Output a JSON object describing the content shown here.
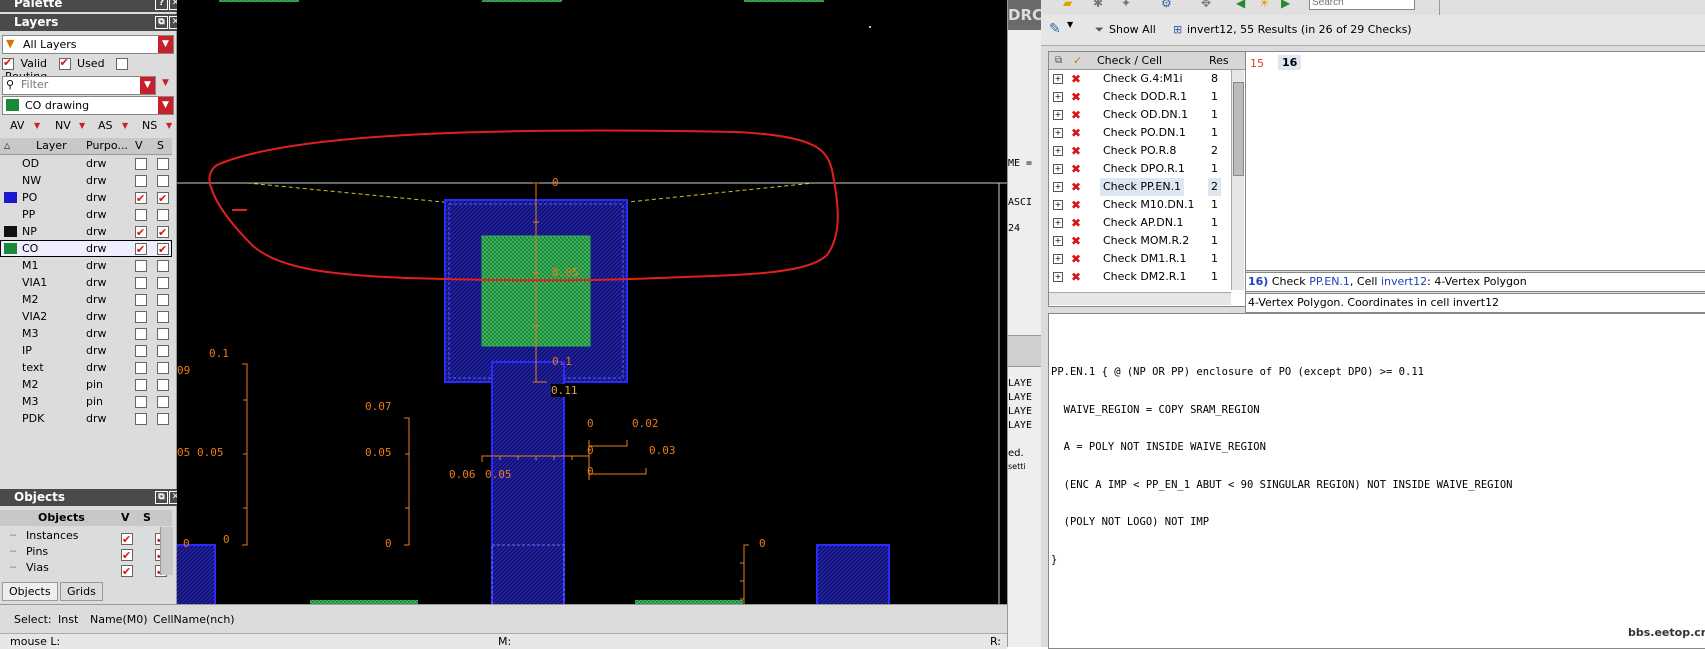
{
  "left_panel": {
    "palette_title": "Palette",
    "layers_title": "Layers",
    "layer_set": "All Layers",
    "valid_label": "Valid",
    "used_label": "Used",
    "routing_label": "Routing",
    "filter_placeholder": "Filter",
    "current_layer": "CO drawing",
    "vis_buttons": [
      "AV",
      "NV",
      "AS",
      "NS"
    ],
    "table_headers": {
      "layer": "Layer",
      "purpose": "Purpo...",
      "v": "V",
      "s": "S"
    },
    "layers": [
      {
        "name": "OD",
        "purpose": "drw",
        "color": "",
        "v": false,
        "s": false
      },
      {
        "name": "NW",
        "purpose": "drw",
        "color": "",
        "v": false,
        "s": false
      },
      {
        "name": "PO",
        "purpose": "drw",
        "color": "#1a1acc",
        "v": true,
        "s": true
      },
      {
        "name": "PP",
        "purpose": "drw",
        "color": "",
        "v": false,
        "s": false
      },
      {
        "name": "NP",
        "purpose": "drw",
        "color": "#111111",
        "v": true,
        "s": true
      },
      {
        "name": "CO",
        "purpose": "drw",
        "color": "#1a8a3a",
        "v": true,
        "s": true
      },
      {
        "name": "M1",
        "purpose": "drw",
        "color": "",
        "v": false,
        "s": false
      },
      {
        "name": "VIA1",
        "purpose": "drw",
        "color": "",
        "v": false,
        "s": false
      },
      {
        "name": "M2",
        "purpose": "drw",
        "color": "",
        "v": false,
        "s": false
      },
      {
        "name": "VIA2",
        "purpose": "drw",
        "color": "",
        "v": false,
        "s": false
      },
      {
        "name": "M3",
        "purpose": "drw",
        "color": "",
        "v": false,
        "s": false
      },
      {
        "name": "IP",
        "purpose": "drw",
        "color": "",
        "v": false,
        "s": false
      },
      {
        "name": "text",
        "purpose": "drw",
        "color": "",
        "v": false,
        "s": false
      },
      {
        "name": "M2",
        "purpose": "pin",
        "color": "",
        "v": false,
        "s": false
      },
      {
        "name": "M3",
        "purpose": "pin",
        "color": "",
        "v": false,
        "s": false
      },
      {
        "name": "PDK",
        "purpose": "drw",
        "color": "",
        "v": false,
        "s": false
      }
    ],
    "objects_title": "Objects",
    "objects_headers": {
      "name": "Objects",
      "v": "V",
      "s": "S"
    },
    "objects": [
      "Instances",
      "Pins",
      "Vias"
    ],
    "bottom_tabs": [
      "Objects",
      "Grids"
    ]
  },
  "canvas": {
    "rulers": [
      "0",
      "0.05",
      "0.1",
      "0.11",
      "0.1",
      "09",
      "05",
      "0.05",
      "0",
      "0",
      "0.07",
      "0.05",
      "0",
      "0.06",
      "0.05",
      "0",
      "0.02",
      "0",
      "0.03",
      "0",
      "0"
    ]
  },
  "status_bar": {
    "select": "Select:",
    "inst": "Inst",
    "name": "Name(M0)",
    "cellname": "CellName(nch)",
    "mouse_l": "mouse L:",
    "m": "M:",
    "r": "R:"
  },
  "middle_strip": {
    "lines": [
      "DRC",
      "ME =",
      "ASCI",
      "24",
      "LAYE",
      "LAYE",
      "LAYE",
      "LAYE",
      "ed.",
      "setti"
    ]
  },
  "drc_panel": {
    "show_all": "Show All",
    "summary": "invert12, 55 Results (in 26 of 29 Checks)",
    "search_placeholder": "Search",
    "tree_headers": {
      "check": "Check / Cell",
      "res": "Res"
    },
    "checks": [
      {
        "name": "Check G.4:M1i",
        "res": "8"
      },
      {
        "name": "Check DOD.R.1",
        "res": "1"
      },
      {
        "name": "Check OD.DN.1",
        "res": "1"
      },
      {
        "name": "Check PO.DN.1",
        "res": "1"
      },
      {
        "name": "Check PO.R.8",
        "res": "2"
      },
      {
        "name": "Check DPO.R.1",
        "res": "1"
      },
      {
        "name": "Check PP.EN.1",
        "res": "2"
      },
      {
        "name": "Check M10.DN.1",
        "res": "1"
      },
      {
        "name": "Check AP.DN.1",
        "res": "1"
      },
      {
        "name": "Check MOM.R.2",
        "res": "1"
      },
      {
        "name": "Check DM1.R.1",
        "res": "1"
      },
      {
        "name": "Check DM2.R.1",
        "res": "1"
      }
    ],
    "result_ids": [
      "15",
      "16"
    ],
    "detail_num": "16)",
    "detail_check_prefix": "Check",
    "detail_check": "PP.EN.1",
    "detail_cell_prefix": ", Cell",
    "detail_cell": "invert12",
    "detail_suffix": ": 4-Vertex Polygon",
    "detail_desc": "4-Vertex Polygon. Coordinates in cell invert12",
    "rule_text": [
      "PP.EN.1 { @ (NP OR PP) enclosure of PO (except DPO) >= 0.11",
      "  WAIVE_REGION = COPY SRAM_REGION",
      "  A = POLY NOT INSIDE WAIVE_REGION",
      "  (ENC A IMP < PP_EN_1 ABUT < 90 SINGULAR REGION) NOT INSIDE WAIVE_REGION",
      "  (POLY NOT LOGO) NOT IMP",
      "}"
    ]
  },
  "watermark": "bbs.eetop.cn"
}
